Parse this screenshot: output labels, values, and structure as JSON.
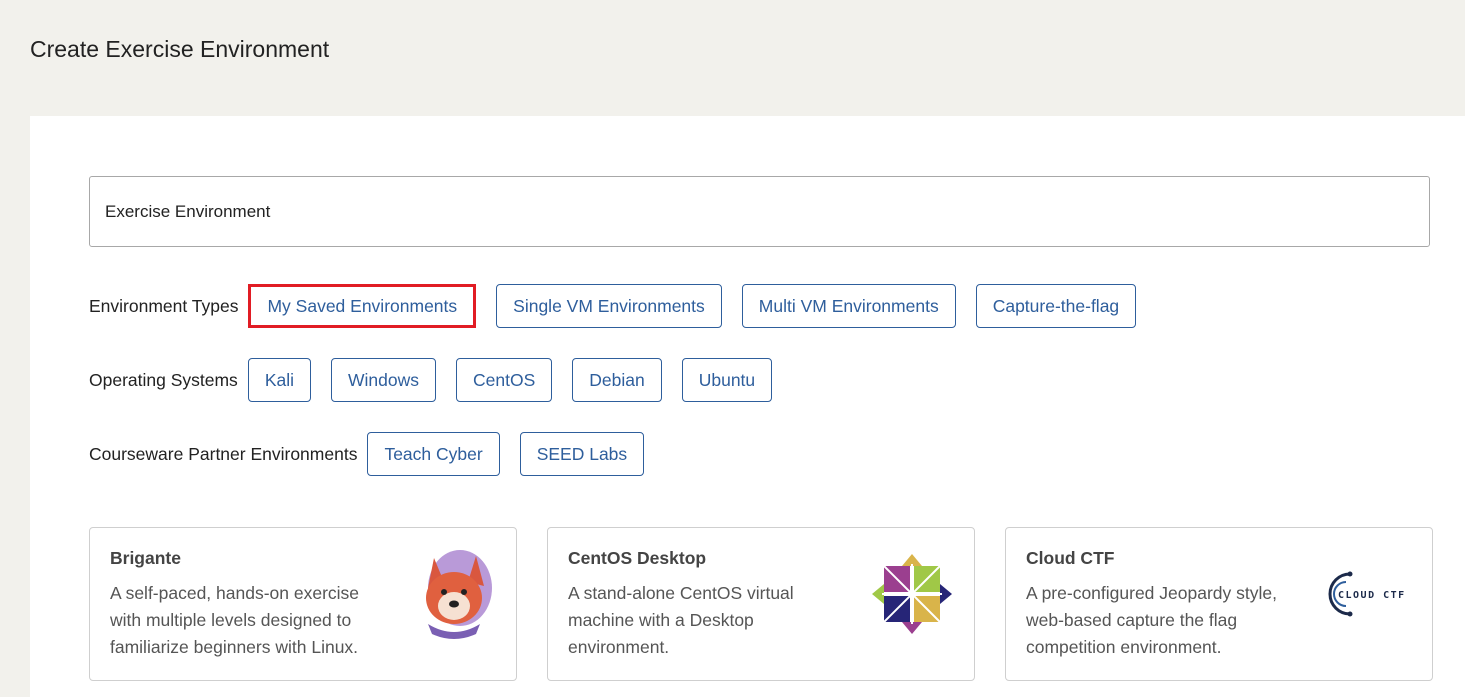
{
  "page": {
    "title": "Create Exercise Environment"
  },
  "search": {
    "value": "",
    "placeholder": "Exercise Environment"
  },
  "filters": {
    "environment_types": {
      "label": "Environment Types",
      "options": [
        "My Saved Environments",
        "Single VM Environments",
        "Multi VM Environments",
        "Capture-the-flag"
      ]
    },
    "operating_systems": {
      "label": "Operating Systems",
      "options": [
        "Kali",
        "Windows",
        "CentOS",
        "Debian",
        "Ubuntu"
      ]
    },
    "courseware_partners": {
      "label": "Courseware Partner Environments",
      "options": [
        "Teach Cyber",
        "SEED Labs"
      ]
    }
  },
  "cards": [
    {
      "title": "Brigante",
      "description": "A self-paced, hands-on exercise with multiple levels designed to familiarize beginners with Linux.",
      "icon": "brigante-dog-logo-icon"
    },
    {
      "title": "CentOS Desktop",
      "description": "A stand-alone CentOS virtual machine with a Desktop environment.",
      "icon": "centos-logo-icon"
    },
    {
      "title": "Cloud CTF",
      "description": "A pre-configured Jeopardy style, web-based capture the flag competition environment.",
      "icon": "cloud-ctf-logo-icon",
      "logo_text": "CLOUD CTF"
    }
  ],
  "colors": {
    "page_background": "#f2f1ec",
    "panel_background": "#ffffff",
    "chip_accent": "#2e5e9c",
    "highlight_border": "#e11c24"
  }
}
